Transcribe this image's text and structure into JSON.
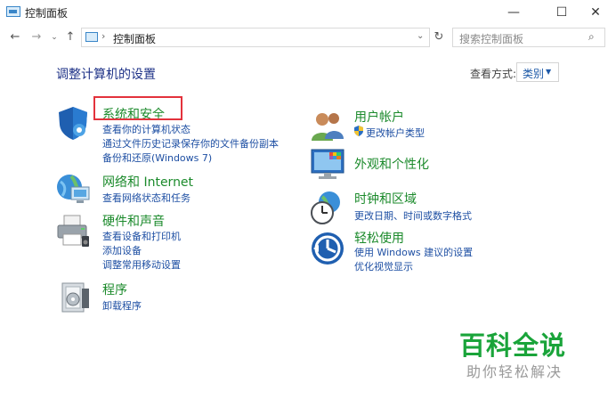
{
  "window": {
    "title": "控制面板",
    "minimize_glyph": "—",
    "maximize_glyph": "☐",
    "close_glyph": "✕"
  },
  "nav": {
    "back_glyph": "←",
    "forward_glyph": "→",
    "dropdown_glyph": "⌄",
    "up_glyph": "↑",
    "address_separator": "›",
    "address_text": "控制面板",
    "address_dropdown_glyph": "⌄",
    "refresh_glyph": "↻",
    "search_placeholder": "搜索控制面板",
    "search_glyph": "⌕"
  },
  "main": {
    "heading": "调整计算机的设置",
    "view_by_label": "查看方式:",
    "view_by_value": "类别",
    "view_by_arrow": "▼"
  },
  "left_categories": [
    {
      "title": "系统和安全",
      "icon": "shield-icon",
      "links": [
        "查看你的计算机状态",
        "通过文件历史记录保存你的文件备份副本",
        "备份和还原(Windows 7)"
      ]
    },
    {
      "title": "网络和 Internet",
      "icon": "globe-network-icon",
      "links": [
        "查看网络状态和任务"
      ]
    },
    {
      "title": "硬件和声音",
      "icon": "printer-icon",
      "links": [
        "查看设备和打印机",
        "添加设备",
        "调整常用移动设置"
      ]
    },
    {
      "title": "程序",
      "icon": "programs-icon",
      "links": [
        "卸载程序"
      ]
    }
  ],
  "right_categories": [
    {
      "title": "用户帐户",
      "icon": "users-icon",
      "links": [
        "更改帐户类型"
      ]
    },
    {
      "title": "外观和个性化",
      "icon": "monitor-palette-icon",
      "links": []
    },
    {
      "title": "时钟和区域",
      "icon": "clock-globe-icon",
      "links": [
        "更改日期、时间或数字格式"
      ]
    },
    {
      "title": "轻松使用",
      "icon": "ease-of-access-icon",
      "links": [
        "使用 Windows 建议的设置",
        "优化视觉显示"
      ]
    }
  ],
  "watermark": {
    "title": "百科全说",
    "subtitle": "助你轻松解决"
  },
  "colors": {
    "category_title": "#1b8a2b",
    "link": "#1e4fa3",
    "heading": "#1e3287",
    "highlight_box": "#e3323c",
    "watermark_green": "#1aa43a"
  }
}
